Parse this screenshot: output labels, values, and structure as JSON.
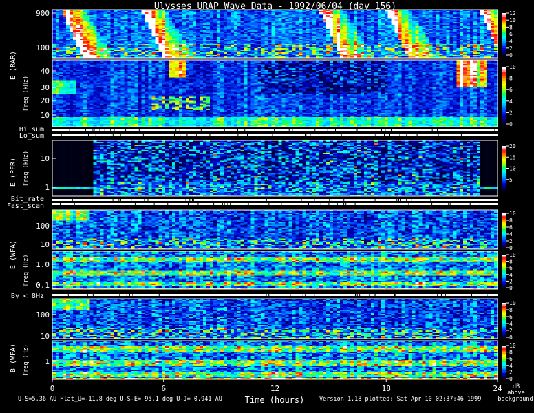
{
  "chart_data": {
    "type": "heatmap",
    "title": "Ulysses URAP Wave Data - 1992/06/04  (day 156)",
    "xlabel": "Time (hours)",
    "x_ticks": [
      "0",
      "6",
      "12",
      "18",
      "24"
    ],
    "xlim": [
      0,
      24
    ],
    "panels": [
      {
        "id": "rar_hi",
        "group": "E (RAR)",
        "ylabel": "",
        "yticks": [
          "900",
          "100"
        ],
        "ylim": [
          60,
          950
        ],
        "log": true,
        "cbar_ticks": [
          "12",
          "10",
          "8",
          "6",
          "4",
          "2",
          "0"
        ],
        "cbar_max": 12
      },
      {
        "id": "rar_lo",
        "group": "E (RAR)",
        "ylabel": "Freq (kHz)",
        "yticks": [
          "40",
          "30",
          "20",
          "10"
        ],
        "ylim": [
          0,
          50
        ],
        "log": false,
        "cbar_ticks": [
          "10",
          "8",
          "6",
          "4",
          "2",
          "0"
        ],
        "cbar_max": 10
      },
      {
        "id": "pfr",
        "group": "E (PFR)",
        "ylabel": "Freq (kHz)",
        "yticks": [
          "10",
          "1"
        ],
        "ylim": [
          0.6,
          30
        ],
        "log": true,
        "cbar_ticks": [
          "20",
          "15",
          "10",
          "5"
        ],
        "cbar_max": 20
      },
      {
        "id": "wfa_e_hi",
        "group": "E (WFA)",
        "ylabel": "",
        "yticks": [
          "100",
          "10"
        ],
        "ylim": [
          8,
          450
        ],
        "log": true,
        "cbar_ticks": [
          "10",
          "8",
          "6",
          "4",
          "2",
          "0"
        ],
        "cbar_max": 10
      },
      {
        "id": "wfa_e_lo",
        "group": "E (WFA)",
        "ylabel": "Freq (Hz)",
        "yticks": [
          "1.0",
          "0.1"
        ],
        "ylim": [
          0.08,
          8
        ],
        "log": true,
        "cbar_ticks": [
          "10",
          "8",
          "6",
          "4",
          "2",
          "0"
        ],
        "cbar_max": 10
      },
      {
        "id": "wfa_b_hi",
        "group": "B (WFA)",
        "ylabel": "",
        "yticks": [
          "100",
          "10"
        ],
        "ylim": [
          8,
          450
        ],
        "log": true,
        "cbar_ticks": [
          "10",
          "8",
          "6",
          "4",
          "2",
          "0"
        ],
        "cbar_max": 10
      },
      {
        "id": "wfa_b_lo",
        "group": "B (WFA)",
        "ylabel": "Freq (Hz)",
        "yticks": [
          "1"
        ],
        "ylim": [
          0.08,
          8
        ],
        "log": true,
        "cbar_ticks": [
          "10",
          "8",
          "6",
          "4",
          "2",
          "0"
        ],
        "cbar_max": 10
      }
    ],
    "group_labels": [
      "E (RAR)",
      "E (PFR)",
      "E (WFA)",
      "B (WFA)"
    ],
    "status_labels": [
      "Hi_sum",
      "Lo_sum",
      "Bit_rate",
      "Fast_scan",
      "By < 8Hz"
    ],
    "colorbar_unit": [
      "dB",
      "above",
      "background"
    ],
    "colormap": [
      "#000000",
      "#00005a",
      "#0000c8",
      "#0050ff",
      "#00b4ff",
      "#00ffff",
      "#00ff78",
      "#b4ff00",
      "#ffff00",
      "#ff8c00",
      "#ff0000",
      "#ffffff"
    ],
    "annotations": {
      "left": "U-S=5.36 AU  Hlat_U=-11.8 deg  U-S-E= 95.1 deg  U-J= 0.941 AU",
      "right": "Version 1.18 plotted: Sat Apr 10 02:37:46 1999"
    }
  }
}
